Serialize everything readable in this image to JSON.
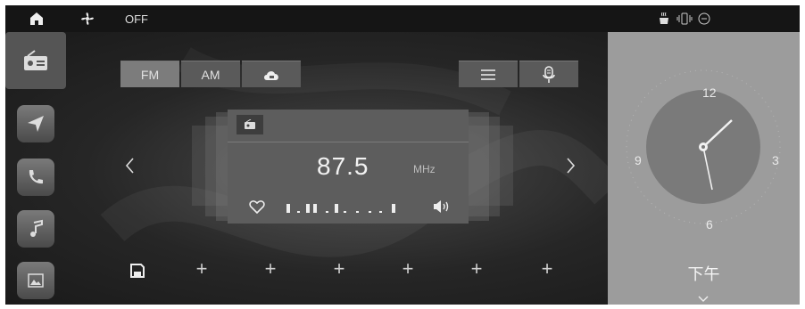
{
  "status_bar": {
    "hvac_state": "OFF",
    "icons": [
      "home-icon",
      "fan-icon",
      "seat-heat-icon",
      "vibration-icon",
      "auto-icon"
    ]
  },
  "sidebar": {
    "items": [
      {
        "name": "radio-icon"
      },
      {
        "name": "navigation-icon"
      },
      {
        "name": "phone-icon"
      },
      {
        "name": "music-icon"
      },
      {
        "name": "gallery-icon"
      }
    ]
  },
  "tabs": {
    "fm_label": "FM",
    "am_label": "AM",
    "cloud_icon": "cloud-radio-icon",
    "list_icon": "list-icon",
    "voice_icon": "voice-icon"
  },
  "station": {
    "frequency": "87.5",
    "unit": "MHz",
    "favorite_icon": "heart-icon",
    "volume_icon": "speaker-icon"
  },
  "presets": {
    "save_icon": "save-icon",
    "slots": [
      "+",
      "+",
      "+",
      "+",
      "+",
      "+"
    ]
  },
  "clock": {
    "numbers": {
      "twelve": "12",
      "three": "3",
      "six": "6",
      "nine": "9"
    },
    "period": "下午"
  },
  "colors": {
    "background": "#262626",
    "clock_panel": "#9c9c9c",
    "active_tab": "#7c7c7c"
  }
}
